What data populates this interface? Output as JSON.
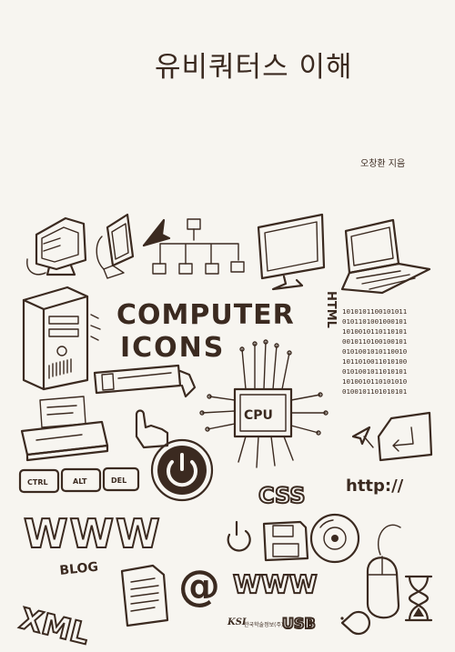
{
  "book": {
    "title": "유비쿼터스 이해",
    "author": "오창환 지음",
    "publisher_logo": "KSI",
    "publisher_name": "한국학술정보(주)"
  },
  "illustration": {
    "computer_icons_line1": "COMPUTER",
    "computer_icons_line2": "ICONS",
    "cpu_label": "CPU",
    "html_label": "HTML",
    "css_label": "CSS",
    "http_label": "http://",
    "www_large": "WWW",
    "www_small": "WWW",
    "blog_label": "BLOG",
    "xml_label": "XML",
    "usb_label": "USB",
    "at_sign": "@",
    "key_ctrl": "CTRL",
    "key_alt": "ALT",
    "key_del": "DEL",
    "binary_rows": [
      "1010101100101011",
      "0101101001000101",
      "1010010110110101",
      "0010110100100101",
      "0101001010110010",
      "1011010011010100",
      "0101001011010101",
      "1010010110101010",
      "0100101101010101"
    ]
  }
}
